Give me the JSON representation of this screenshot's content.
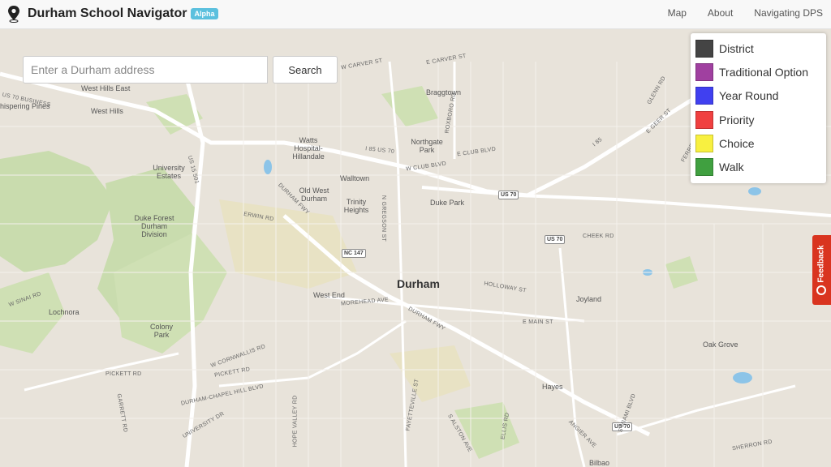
{
  "navbar": {
    "title": "Durham School Navigator",
    "badge": "Alpha",
    "links": [
      "Map",
      "About",
      "Navigating DPS"
    ]
  },
  "search": {
    "placeholder": "Enter a Durham address",
    "button_label": "Search"
  },
  "legend": {
    "items": [
      {
        "label": "District",
        "color": "#444444"
      },
      {
        "label": "Traditional Option",
        "color": "#a040a0"
      },
      {
        "label": "Year Round",
        "color": "#4040f0"
      },
      {
        "label": "Priority",
        "color": "#f04040"
      },
      {
        "label": "Choice",
        "color": "#f8f040"
      },
      {
        "label": "Walk",
        "color": "#40a040"
      }
    ]
  },
  "feedback": {
    "label": "Feedback"
  },
  "map": {
    "city_label": "Durham",
    "place_labels": {
      "west_hills_east": "West Hills East",
      "west_hills": "West Hills",
      "whispering_pines": "hispering Pines",
      "braggtown": "Braggtown",
      "watts_hillandale": "Watts Hospital-Hillandale",
      "northgate_park": "Northgate Park",
      "university_estates": "University Estates",
      "walltown": "Walltown",
      "old_west_durham": "Old West Durham",
      "trinity_heights": "Trinity Heights",
      "duke_park": "Duke Park",
      "duke_forest": "Duke Forest Durham Division",
      "west_end": "West End",
      "lochnora": "Lochnora",
      "colony_park": "Colony Park",
      "joyland": "Joyland",
      "oak_grove": "Oak Grove",
      "hayes": "Hayes",
      "bilbao": "Bilbao"
    },
    "road_labels": {
      "us70_business": "US 70 BUSINESS",
      "w_carver": "W CARVER ST",
      "e_carver": "E CARVER ST",
      "i85_top": "I 85 US 70",
      "i85_right": "I 85",
      "e_club": "E CLUB BLVD",
      "w_club": "W CLUB BLVD",
      "us70_a": "US 70",
      "us70_b": "US 70",
      "erwin": "ERWIN RD",
      "nc147": "NC 147",
      "durham_fwy": "DURHAM FWY",
      "morehead": "MOREHEAD AVE",
      "durham_fwy_2": "DURHAM FWY",
      "holloway": "HOLLOWAY ST",
      "cheek": "CHEEK RD",
      "e_main": "E MAIN ST",
      "w_cornwallis": "W CORNWALLIS RD",
      "pickett_a": "PICKETT RD",
      "pickett_b": "PICKETT RD",
      "durham_chapel_hill": "DURHAM-CHAPEL HILL BLVD",
      "university_dr": "UNIVERSITY DR",
      "hope_valley": "HOPE VALLEY RD",
      "fayetteville": "FAYETTEVILLE ST",
      "s_alston": "S ALSTON AVE",
      "e_geer": "E GEER ST",
      "glenn": "GLENN RD",
      "ferrell": "FERRELL RD",
      "s_miami": "S MIAMI BLVD",
      "sherron": "SHERRON RD",
      "angier": "ANGIER AVE",
      "us70_c": "US 70",
      "us15_501": "US 15 501",
      "roxboro": "ROXBORO RD",
      "n_gregson": "N GREGSON ST",
      "ellis": "ELLIS RD",
      "w_sinai": "W SINAI RD",
      "garrett": "GARRETT RD"
    }
  }
}
